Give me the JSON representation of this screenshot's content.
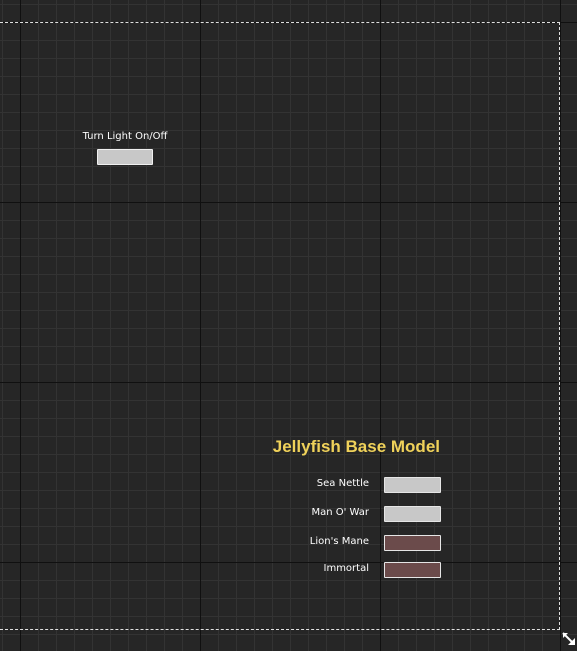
{
  "light_control": {
    "label": "Turn Light On/Off",
    "button_color": "#c8c8c8"
  },
  "jellyfish_panel": {
    "title": "Jellyfish Base Model",
    "title_color": "#f0d25a",
    "options": [
      {
        "label": "Sea Nettle",
        "color": "#c8c8c8"
      },
      {
        "label": "Man O' War",
        "color": "#c8c8c8"
      },
      {
        "label": "Lion's Mane",
        "color": "#6b4b4b"
      },
      {
        "label": "Immortal",
        "color": "#6b4b4b"
      }
    ]
  },
  "canvas": {
    "background": "#262626",
    "resize_handle_icon": "resize-handle-icon"
  }
}
